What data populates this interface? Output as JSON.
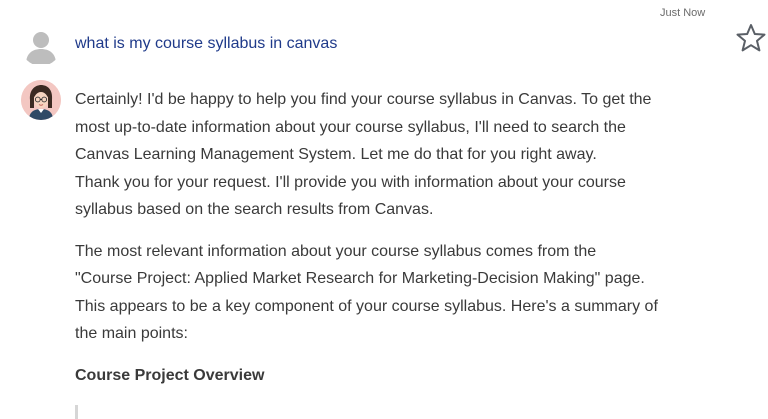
{
  "timestamp": "Just Now",
  "favorite": {
    "icon": "star-outline-icon"
  },
  "user": {
    "avatar_icon": "user-silhouette-icon",
    "question": "what is my course syllabus in canvas"
  },
  "assistant": {
    "avatar_icon": "assistant-avatar-icon",
    "lines_para1": [
      "Certainly! I'd be happy to help you find your course syllabus in Canvas. To get the",
      "most up-to-date information about your course syllabus, I'll need to search the",
      "Canvas Learning Management System. Let me do that for you right away.",
      "Thank you for your request. I'll provide you with information about your course",
      "syllabus based on the search results from Canvas."
    ],
    "lines_para2": [
      "The most relevant information about your course syllabus comes from the",
      "\"Course Project: Applied Market Research for Marketing-Decision Making\" page.",
      "This appears to be a key component of your course syllabus. Here's a summary of",
      "the main points:"
    ],
    "heading": "Course Project Overview"
  },
  "colors": {
    "question_text": "#1f3a8a",
    "body_text": "#3a3a3a",
    "assistant_avatar_bg": "#f3c7c2"
  }
}
